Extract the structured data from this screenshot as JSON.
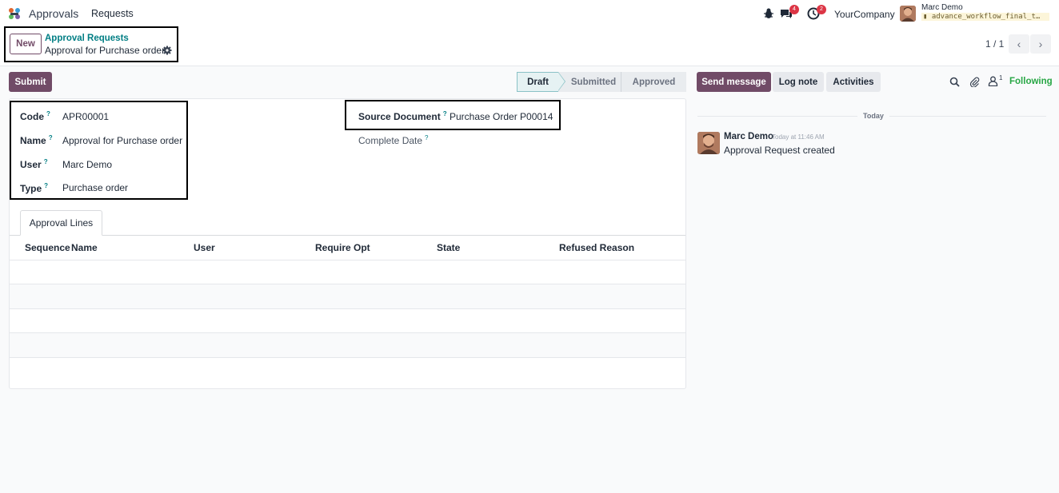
{
  "navbar": {
    "app_name": "Approvals",
    "menu_requests": "Requests",
    "messages_count": "4",
    "activities_count": "2",
    "company": "YourCompany",
    "user_name": "Marc Demo",
    "db_name": "advance_workflow_final_t…"
  },
  "control_panel": {
    "new_label": "New",
    "breadcrumb_parent": "Approval Requests",
    "breadcrumb_current": "Approval for Purchase order",
    "pager": "1 / 1"
  },
  "statusbar": {
    "submit_label": "Submit",
    "stages": [
      "Draft",
      "Submitted",
      "Approved"
    ],
    "active_stage": "Draft"
  },
  "form": {
    "code_label": "Code",
    "code_value": "APR00001",
    "name_label": "Name",
    "name_value": "Approval for Purchase order",
    "user_label": "User",
    "user_value": "Marc Demo",
    "type_label": "Type",
    "type_value": "Purchase order",
    "source_label": "Source Document",
    "source_value": "Purchase Order P00014",
    "complete_date_label": "Complete Date",
    "help_mark": "?"
  },
  "approval_lines": {
    "tab_label": "Approval Lines",
    "columns": [
      "Sequence",
      "Name",
      "User",
      "Require Opt",
      "State",
      "Refused Reason"
    ]
  },
  "chatter": {
    "send_message": "Send message",
    "log_note": "Log note",
    "activities": "Activities",
    "followers_count": "1",
    "following": "Following",
    "date_separator": "Today",
    "message_author": "Marc Demo",
    "message_time": "Today at 11:46 AM",
    "message_body": "Approval Request created"
  },
  "colors": {
    "brand": "#714b67",
    "link": "#017e84",
    "following": "#28a745",
    "badge": "#dc3545"
  }
}
